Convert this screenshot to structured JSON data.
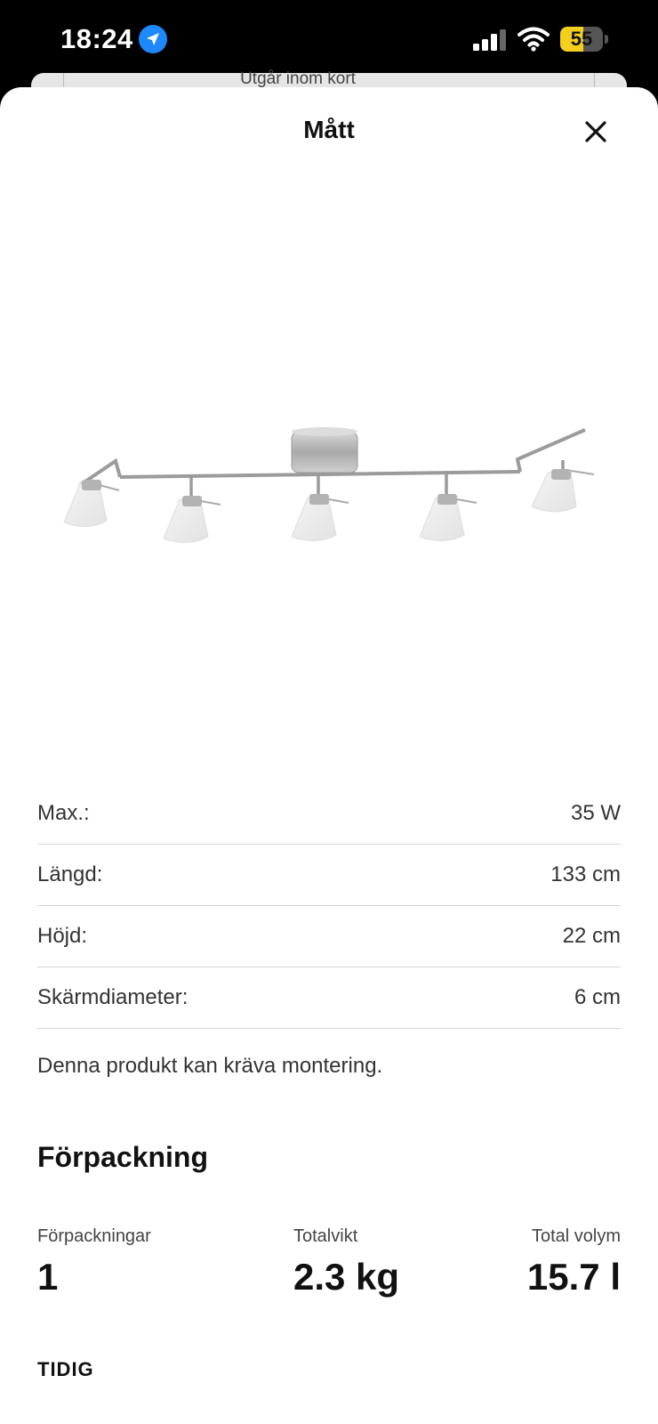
{
  "status_bar": {
    "time": "18:24",
    "battery": "55",
    "battery_level": 0.55
  },
  "background_page": {
    "text": "Utgår inom kort"
  },
  "sheet": {
    "title": "Mått"
  },
  "dimensions": [
    {
      "label": "Max.:",
      "value": "35 W"
    },
    {
      "label": "Längd:",
      "value": "133 cm"
    },
    {
      "label": "Höjd:",
      "value": "22 cm"
    },
    {
      "label": "Skärmdiameter:",
      "value": "6 cm"
    }
  ],
  "note": "Denna produkt kan kräva montering.",
  "packaging": {
    "heading": "Förpackning",
    "items": [
      {
        "label": "Förpackningar",
        "value": "1"
      },
      {
        "label": "Totalvikt",
        "value": "2.3 kg"
      },
      {
        "label": "Total volym",
        "value": "15.7 l"
      }
    ]
  },
  "footer_label": "TIDIG",
  "icons": {
    "location": "location-arrow-icon",
    "signal": "cellular-signal-icon",
    "wifi": "wifi-icon",
    "close": "close-icon"
  },
  "colors": {
    "location_blue": "#1e88ff",
    "battery_yellow": "#f5cf1d"
  }
}
